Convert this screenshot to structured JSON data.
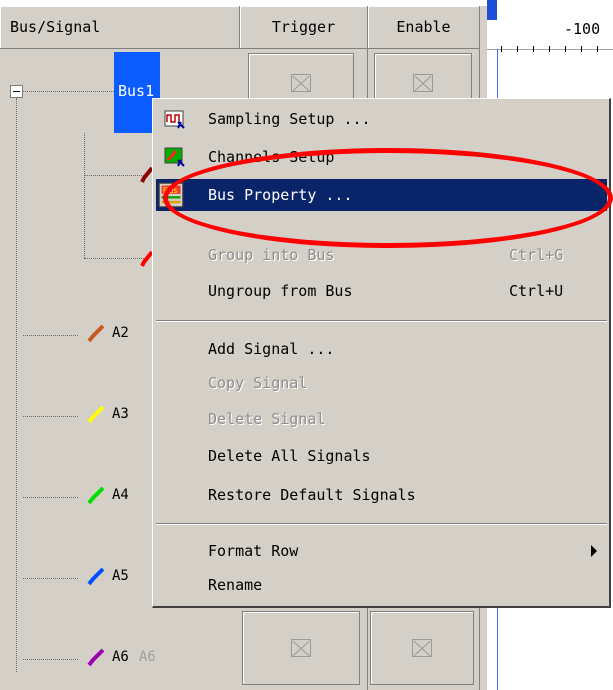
{
  "columns": {
    "bus_signal": "Bus/Signal",
    "trigger": "Trigger",
    "enable": "Enable"
  },
  "timeline": {
    "ruler_label": "-100"
  },
  "bus": {
    "label": "Bus1"
  },
  "signals": [
    {
      "label": "A2",
      "color": "#c85a1e"
    },
    {
      "label": "A3",
      "color": "#ffff00"
    },
    {
      "label": "A4",
      "color": "#00e000"
    },
    {
      "label": "A5",
      "color": "#0050ff"
    },
    {
      "label": "A6",
      "color": "#9a00b0",
      "alias": "A6"
    }
  ],
  "bus_children_colors": [
    "#8b0000",
    "#ff0000"
  ],
  "context_menu": {
    "sampling_setup": "Sampling Setup ...",
    "channels_setup": "Channels Setup",
    "bus_property": "Bus Property ...",
    "bus_property_icon_text": "Bus",
    "group_into_bus": "Group into Bus",
    "group_into_bus_shortcut": "Ctrl+G",
    "ungroup_from_bus": "Ungroup from Bus",
    "ungroup_from_bus_shortcut": "Ctrl+U",
    "add_signal": "Add Signal ...",
    "copy_signal": "Copy Signal",
    "delete_signal": "Delete Signal",
    "delete_all_signals": "Delete All Signals",
    "restore_default_signals": "Restore Default Signals",
    "format_row": "Format Row",
    "rename": "Rename"
  },
  "highlight_color": "#ff0000",
  "selection_color": "#0a246a"
}
